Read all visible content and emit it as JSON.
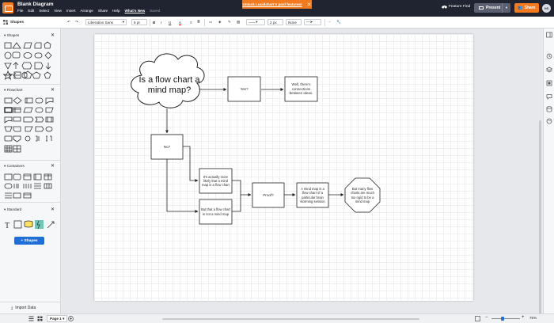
{
  "app": {
    "doc_title": "Blank Diagram",
    "menu": [
      "File",
      "Edit",
      "Select",
      "View",
      "Insert",
      "Arrange",
      "Share",
      "Help"
    ],
    "whats_new": "What's New",
    "saved": "Saved",
    "unlock_banner": "Unlock Lucidchart's paid features!",
    "feature_find": "Feature Find",
    "present": "Present",
    "share": "Share",
    "avatar_initials": "HS"
  },
  "toolbar": {
    "shapes_label": "Shapes",
    "font": "Liberation Sans",
    "font_size": "6 pt",
    "line_width": "2 px",
    "line_start": "None"
  },
  "sidebar": {
    "sections": [
      "Shapes",
      "Flowchart",
      "Containers",
      "Standard"
    ],
    "shapes_button": "+ Shapes",
    "import_data": "Import Data"
  },
  "diagram": {
    "cloud": "Is a flow chart a mind map?",
    "yes": "Yes?",
    "connections": "Well, there's connections between ideas.",
    "no": "No?",
    "more_likely": "It's actually more likely that a mind map is a flow chart",
    "not_mind_map": "But that a flow chart is not a mind map",
    "proof": "Proof?",
    "brainstorm": "A mind map is a flow chart of a particular brain storming session",
    "rigid": "But many flow charts are much too rigid to be a mind map"
  },
  "bottom": {
    "page_tab": "Page 1",
    "zoom": "75%"
  },
  "colors": {
    "topbar": "#1f2430",
    "accent": "#f47a20",
    "primary_button": "#1f6fd6"
  }
}
